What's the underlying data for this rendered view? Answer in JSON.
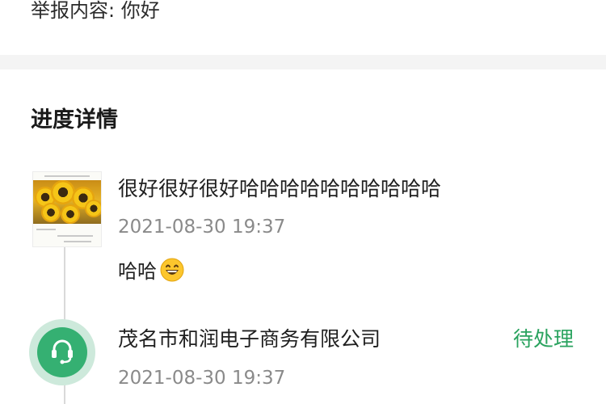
{
  "report": {
    "label": "举报内容:",
    "value": "你好"
  },
  "section": {
    "title": "进度详情"
  },
  "timeline": [
    {
      "title": "很好很好很好哈哈哈哈哈哈哈哈哈哈",
      "time": "2021-08-30 19:37",
      "message": "哈哈",
      "emoji": "grinning-face-emoji"
    },
    {
      "company": "茂名市和润电子商务有限公司",
      "time": "2021-08-30 19:37",
      "status": "待处理",
      "status_color": "#2aa35f",
      "avatar_icon": "headset-icon"
    }
  ]
}
